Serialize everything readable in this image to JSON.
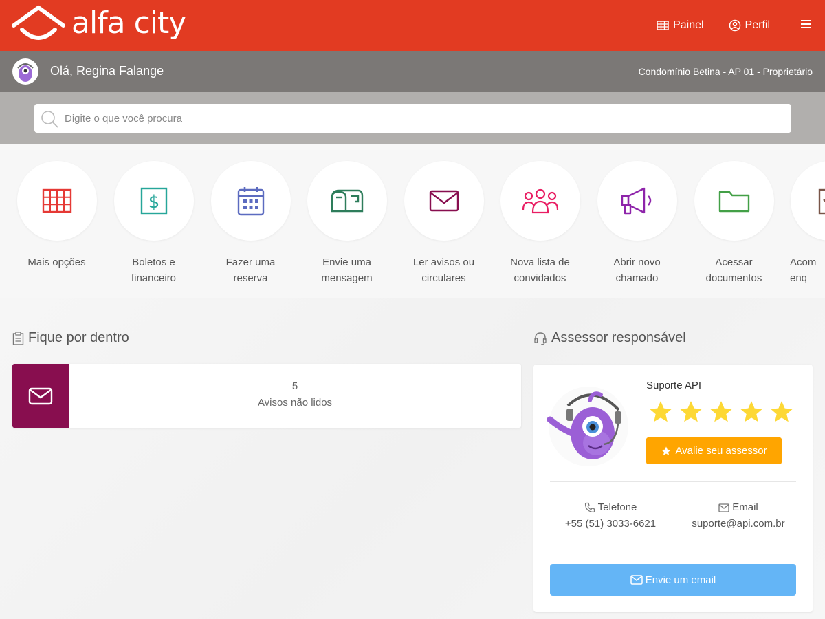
{
  "brand": {
    "name": "alfa city",
    "color": "#e23b22"
  },
  "topnav": {
    "panel_label": "Painel",
    "profile_label": "Perfil"
  },
  "user": {
    "greeting": "Olá, Regina Falange",
    "unit": "Condomínio Betina - AP 01 - Proprietário"
  },
  "search": {
    "placeholder": "Digite o que você procura"
  },
  "actions": [
    {
      "label": "Mais opções",
      "icon": "grid-icon",
      "color": "#e53935"
    },
    {
      "label": "Boletos e financeiro",
      "icon": "dollar-icon",
      "color": "#26a69a"
    },
    {
      "label": "Fazer uma reserva",
      "icon": "calendar-icon",
      "color": "#5c6bc0"
    },
    {
      "label": "Envie uma mensagem",
      "icon": "mailbox-icon",
      "color": "#2e7d5b"
    },
    {
      "label": "Ler avisos ou circulares",
      "icon": "envelope-icon",
      "color": "#880e4f"
    },
    {
      "label": "Nova lista de convidados",
      "icon": "people-icon",
      "color": "#e91e63"
    },
    {
      "label": "Abrir novo chamado",
      "icon": "megaphone-icon",
      "color": "#8e24aa"
    },
    {
      "label": "Acessar documentos",
      "icon": "folder-icon",
      "color": "#43a047"
    },
    {
      "label": "Acom enq",
      "icon": "checklist-icon",
      "color": "#795548"
    }
  ],
  "news": {
    "title": "Fique por dentro",
    "unread_count": "5",
    "unread_label": "Avisos não lidos",
    "accent": "#880e4f"
  },
  "advisor": {
    "title": "Assessor responsável",
    "name": "Suporte API",
    "rating": 5,
    "rating_max": 5,
    "rate_button": "Avalie seu assessor",
    "phone_label": "Telefone",
    "phone": "+55 (51) 3033-6621",
    "email_label": "Email",
    "email": "suporte@api.com.br",
    "email_button": "Envie um email"
  }
}
